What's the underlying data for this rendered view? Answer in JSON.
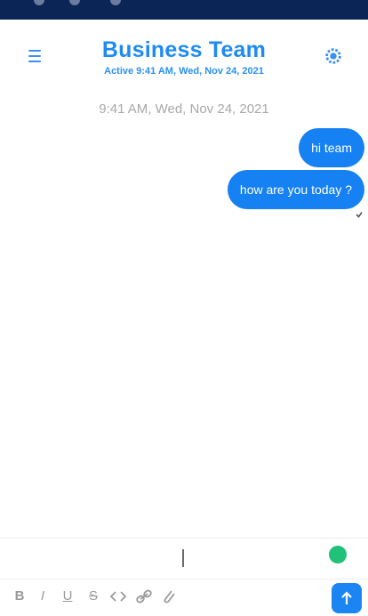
{
  "header": {
    "title": "Business Team",
    "subtitle": "Active 9:41 AM, Wed, Nov 24, 2021"
  },
  "conversation": {
    "timestamp": "9:41 AM, Wed, Nov 24, 2021",
    "messages": [
      {
        "text": "hi team",
        "sender": "me"
      },
      {
        "text": "how are you today ?",
        "sender": "me"
      }
    ]
  },
  "composer": {
    "value": ""
  },
  "toolbar": {
    "items": [
      {
        "icon": "bold-icon",
        "glyph": "B"
      },
      {
        "icon": "italic-icon",
        "glyph": "I"
      },
      {
        "icon": "underline-icon",
        "glyph": "U"
      },
      {
        "icon": "strikethrough-icon",
        "glyph": "S"
      },
      {
        "icon": "code-icon",
        "glyph": "<>"
      },
      {
        "icon": "link-icon",
        "glyph": "link"
      },
      {
        "icon": "attachment-icon",
        "glyph": "attach"
      }
    ]
  },
  "colors": {
    "status_bar": "#0c2557",
    "accent": "#1681f2",
    "emoji": "#21c17a"
  }
}
